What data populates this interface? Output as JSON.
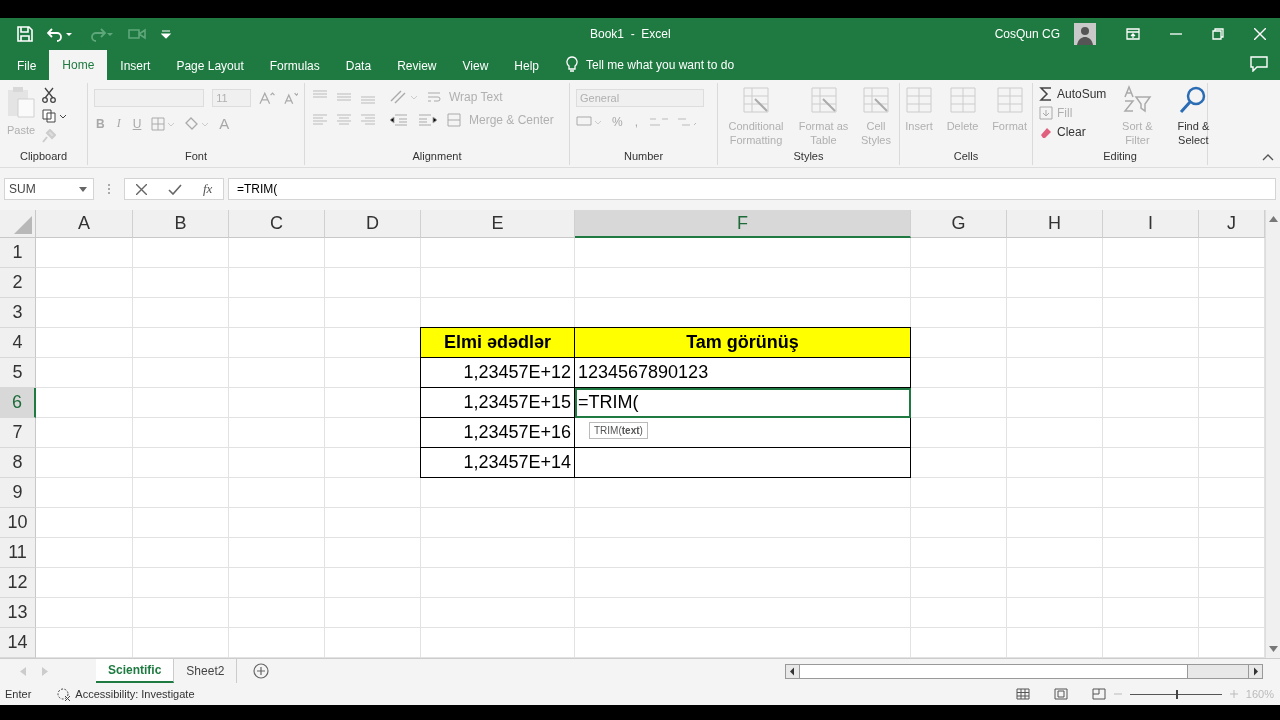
{
  "window": {
    "title": "Book1  -  Excel",
    "user": "CosQun CG"
  },
  "menu_tabs": [
    {
      "label": "File",
      "selected": false
    },
    {
      "label": "Home",
      "selected": true
    },
    {
      "label": "Insert",
      "selected": false
    },
    {
      "label": "Page Layout",
      "selected": false
    },
    {
      "label": "Formulas",
      "selected": false
    },
    {
      "label": "Data",
      "selected": false
    },
    {
      "label": "Review",
      "selected": false
    },
    {
      "label": "View",
      "selected": false
    },
    {
      "label": "Help",
      "selected": false
    }
  ],
  "tell_me": "Tell me what you want to do",
  "ribbon": {
    "clipboard": {
      "label": "Clipboard",
      "paste": "Paste",
      "disabled": true
    },
    "font": {
      "label": "Font",
      "size": "11",
      "styles": [
        "B",
        "I",
        "U"
      ],
      "font_color": "A",
      "disabled": true
    },
    "alignment": {
      "label": "Alignment",
      "wrap_text": "Wrap Text",
      "merge": "Merge & Center",
      "disabled": true
    },
    "number": {
      "label": "Number",
      "format": "General",
      "percent": "%",
      "comma": ",",
      "disabled": true
    },
    "styles": {
      "label": "Styles",
      "commands": [
        {
          "label": "Conditional Formatting",
          "disabled": true
        },
        {
          "label": "Format as Table",
          "disabled": true
        },
        {
          "label": "Cell Styles",
          "disabled": true
        }
      ]
    },
    "cells": {
      "label": "Cells",
      "commands": [
        {
          "label": "Insert",
          "disabled": true
        },
        {
          "label": "Delete",
          "disabled": true
        },
        {
          "label": "Format",
          "disabled": true
        }
      ]
    },
    "editing": {
      "label": "Editing",
      "small": [
        {
          "label": "AutoSum",
          "disabled": false
        },
        {
          "label": "Fill",
          "disabled": true
        },
        {
          "label": "Clear",
          "disabled": false
        }
      ],
      "large": [
        {
          "label": "Sort & Filter",
          "disabled": true
        },
        {
          "label": "Find & Select",
          "disabled": false
        }
      ]
    }
  },
  "formula_bar": {
    "name_box": "SUM",
    "function_button": "fx",
    "formula": "=TRIM("
  },
  "columns": [
    {
      "label": "A",
      "selected": false
    },
    {
      "label": "B",
      "selected": false
    },
    {
      "label": "C",
      "selected": false
    },
    {
      "label": "D",
      "selected": false
    },
    {
      "label": "E",
      "selected": false
    },
    {
      "label": "F",
      "selected": true
    },
    {
      "label": "G",
      "selected": false
    },
    {
      "label": "H",
      "selected": false
    },
    {
      "label": "I",
      "selected": false
    },
    {
      "label": "J",
      "selected": false
    }
  ],
  "rows": [
    {
      "label": "1",
      "selected": false
    },
    {
      "label": "2",
      "selected": false
    },
    {
      "label": "3",
      "selected": false
    },
    {
      "label": "4",
      "selected": false
    },
    {
      "label": "5",
      "selected": false
    },
    {
      "label": "6",
      "selected": true
    },
    {
      "label": "7",
      "selected": false
    },
    {
      "label": "8",
      "selected": false
    },
    {
      "label": "9",
      "selected": false
    },
    {
      "label": "10",
      "selected": false
    },
    {
      "label": "11",
      "selected": false
    },
    {
      "label": "12",
      "selected": false
    },
    {
      "label": "13",
      "selected": false
    },
    {
      "label": "14",
      "selected": false
    }
  ],
  "table": {
    "headers": [
      "Elmi ədədlər",
      "Tam görünüş"
    ],
    "rows": [
      {
        "scientific": "1,23457E+12",
        "full": "1234567890123",
        "editing": false
      },
      {
        "scientific": "1,23457E+15",
        "full": "=TRIM(",
        "editing": true
      },
      {
        "scientific": "1,23457E+16",
        "editing": false
      },
      {
        "scientific": "1,23457E+14",
        "editing": false
      }
    ],
    "formula_tooltip": "TRIM(**text**)"
  },
  "sheet_tabs": [
    {
      "label": "Scientific",
      "selected": true
    },
    {
      "label": "Sheet2",
      "selected": false
    }
  ],
  "status_bar": {
    "mode": "Enter",
    "accessibility": "Accessibility: Investigate",
    "zoom": "160%",
    "zoom_level": {
      "level": 0.5
    }
  }
}
